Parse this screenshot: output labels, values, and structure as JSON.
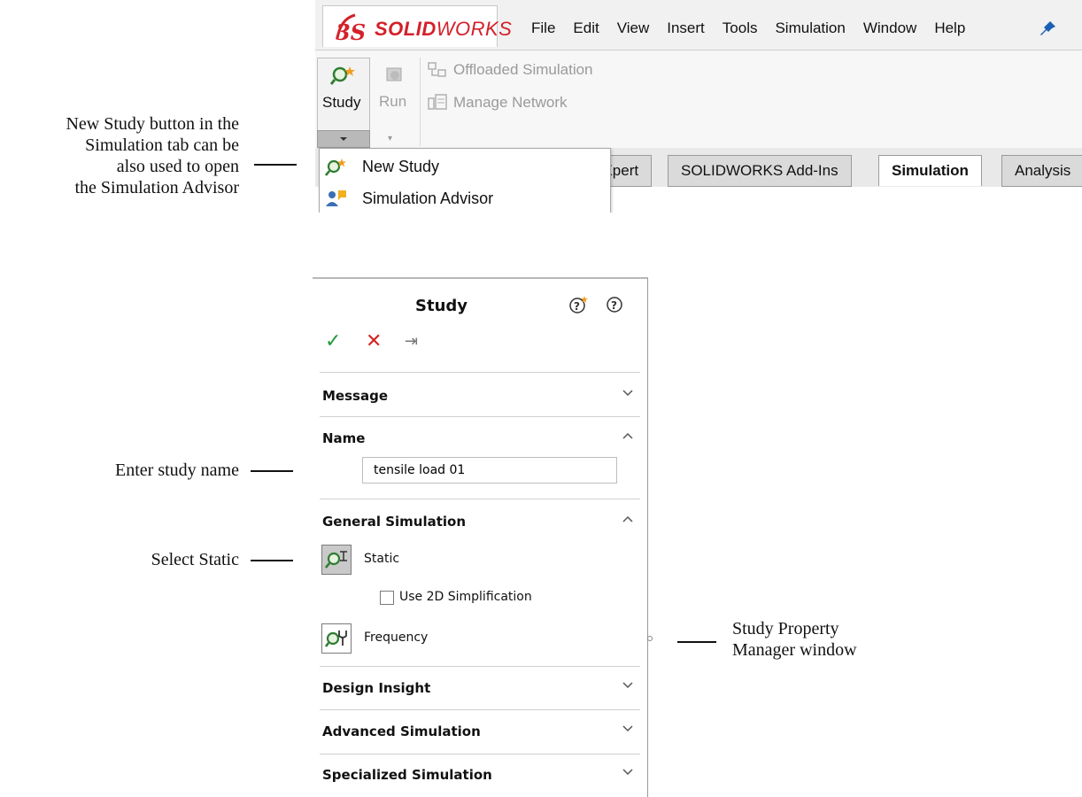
{
  "annotations": {
    "new_study": [
      "New Study button in the",
      "Simulation tab can be",
      "also used to open",
      "the Simulation Advisor"
    ],
    "enter_name": "Enter study name",
    "select_static": "Select Static",
    "property_manager": [
      "Study Property",
      "Manager window"
    ]
  },
  "app": {
    "logo_ds": "DS",
    "logo_solid": "SOLID",
    "logo_works": "WORKS",
    "menu": [
      "File",
      "Edit",
      "View",
      "Insert",
      "Tools",
      "Simulation",
      "Window",
      "Help"
    ]
  },
  "ribbon": {
    "study_label": "Study",
    "run_label": "Run",
    "offloaded": "Offloaded Simulation",
    "manage_network": "Manage Network"
  },
  "tabs": [
    "nXpert",
    "SOLIDWORKS Add-Ins",
    "Simulation",
    "Analysis"
  ],
  "active_tab": "Simulation",
  "dropdown": {
    "items": [
      "New Study",
      "Simulation Advisor"
    ]
  },
  "property_manager": {
    "title": "Study",
    "sections": {
      "message": "Message",
      "name": "Name",
      "general": "General Simulation",
      "design_insight": "Design Insight",
      "advanced": "Advanced Simulation",
      "specialized": "Specialized Simulation"
    },
    "name_value": "tensile load 01",
    "static_label": "Static",
    "use_2d_label": "Use 2D Simplification",
    "use_2d_checked": false,
    "frequency_label": "Frequency"
  },
  "colors": {
    "brand_red": "#d4202a",
    "ok_green": "#1f9a3a",
    "cancel_red": "#d42424"
  }
}
